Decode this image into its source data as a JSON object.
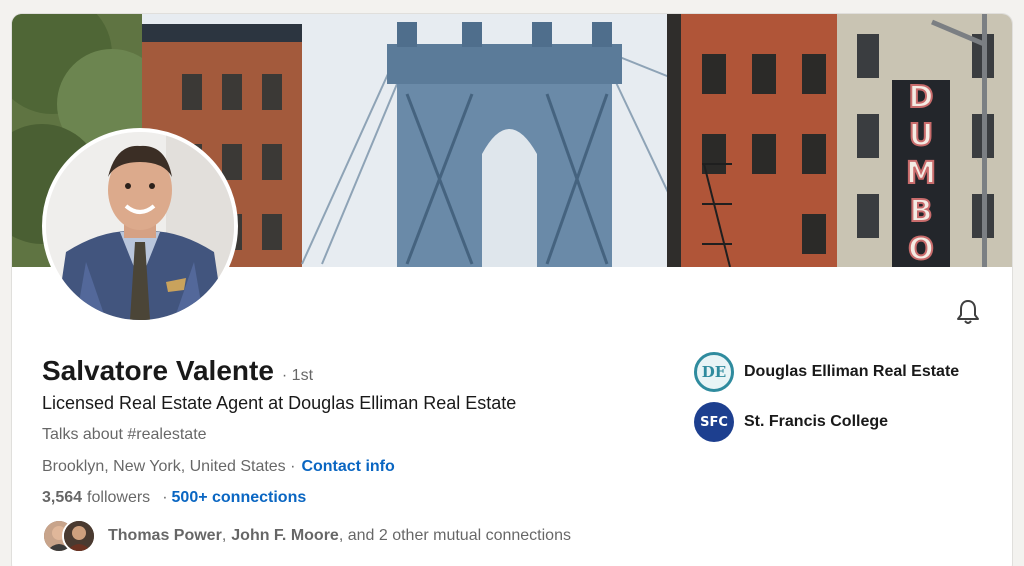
{
  "banner": {
    "sign_letters": [
      "D",
      "U",
      "M",
      "B",
      "O"
    ]
  },
  "profile": {
    "name": "Salvatore Valente",
    "degree": "· 1st",
    "headline": "Licensed Real Estate Agent at Douglas Elliman Real Estate",
    "talks_about": "Talks about #realestate",
    "location": "Brooklyn, New York, United States ·",
    "contact_info_label": "Contact info",
    "followers_count": "3,564",
    "followers_label": "followers",
    "connections_separator": "·",
    "connections_label": "500+ connections"
  },
  "mutual": {
    "name_1": "Thomas Power",
    "separator": ",",
    "name_2": "John F. Moore",
    "suffix": ", and 2 other mutual connections"
  },
  "organizations": [
    {
      "name": "Douglas Elliman Real Estate",
      "logo_text": "DE",
      "logo_color": "#2f8b9e"
    },
    {
      "name": "St. Francis College",
      "logo_text": "SFC",
      "logo_color": "#1d3f8f"
    }
  ],
  "colors": {
    "link": "#0a66c2",
    "background": "#f3f2ef"
  },
  "icons": {
    "bell": "bell-icon"
  }
}
